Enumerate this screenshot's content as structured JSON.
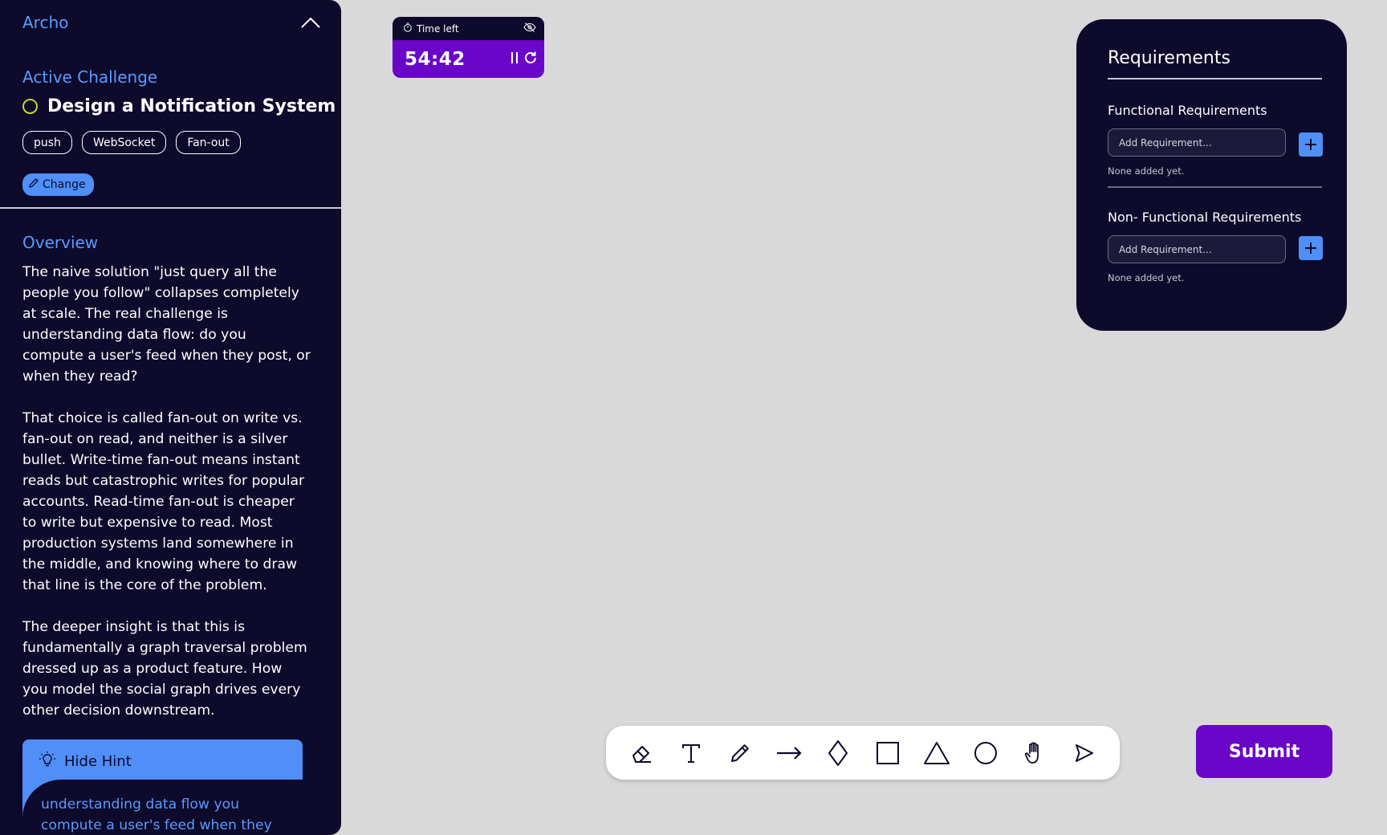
{
  "sidebar": {
    "brand": "Archo",
    "active_challenge_label": "Active Challenge",
    "challenge_title": "Design a Notification System",
    "tags": [
      "push",
      "WebSocket",
      "Fan-out"
    ],
    "change_label": "Change",
    "overview_label": "Overview",
    "overview_paragraphs": [
      "The naive solution \"just query all the people you follow\" collapses completely at scale. The real challenge is understanding data flow: do you compute a user's feed when they post, or when they read?",
      "That choice is called fan-out on write vs. fan-out on read, and neither is a silver bullet. Write-time fan-out means instant reads but catastrophic writes for popular accounts. Read-time fan-out is cheaper to write but expensive to read. Most production systems land somewhere in the middle, and knowing where to draw that line is the core of the problem.",
      "The deeper insight is that this is fundamentally a graph traversal problem dressed up as a product feature. How you model the social graph drives every other decision downstream."
    ],
    "hint_toggle_label": "Hide Hint",
    "hint_text": "understanding data flow you compute a user's feed when they"
  },
  "timer": {
    "label": "Time left",
    "value": "54:42"
  },
  "requirements": {
    "title": "Requirements",
    "functional": {
      "title": "Functional Requirements",
      "placeholder": "Add Requirement...",
      "empty_text": "None added yet."
    },
    "non_functional": {
      "title": "Non- Functional Requirements",
      "placeholder": "Add Requirement...",
      "empty_text": "None added yet."
    }
  },
  "toolbar": {
    "tools": [
      "eraser-icon",
      "text-icon",
      "pencil-icon",
      "arrow-icon",
      "diamond-icon",
      "rectangle-icon",
      "triangle-icon",
      "circle-icon",
      "hand-icon",
      "pointer-icon"
    ]
  },
  "submit_label": "Submit",
  "colors": {
    "panel_bg": "#0d0a2b",
    "canvas_bg": "#d9d9d9",
    "accent_blue": "#4f8ff7",
    "accent_purple": "#6a06c8",
    "status_ring": "#c9d72a"
  }
}
